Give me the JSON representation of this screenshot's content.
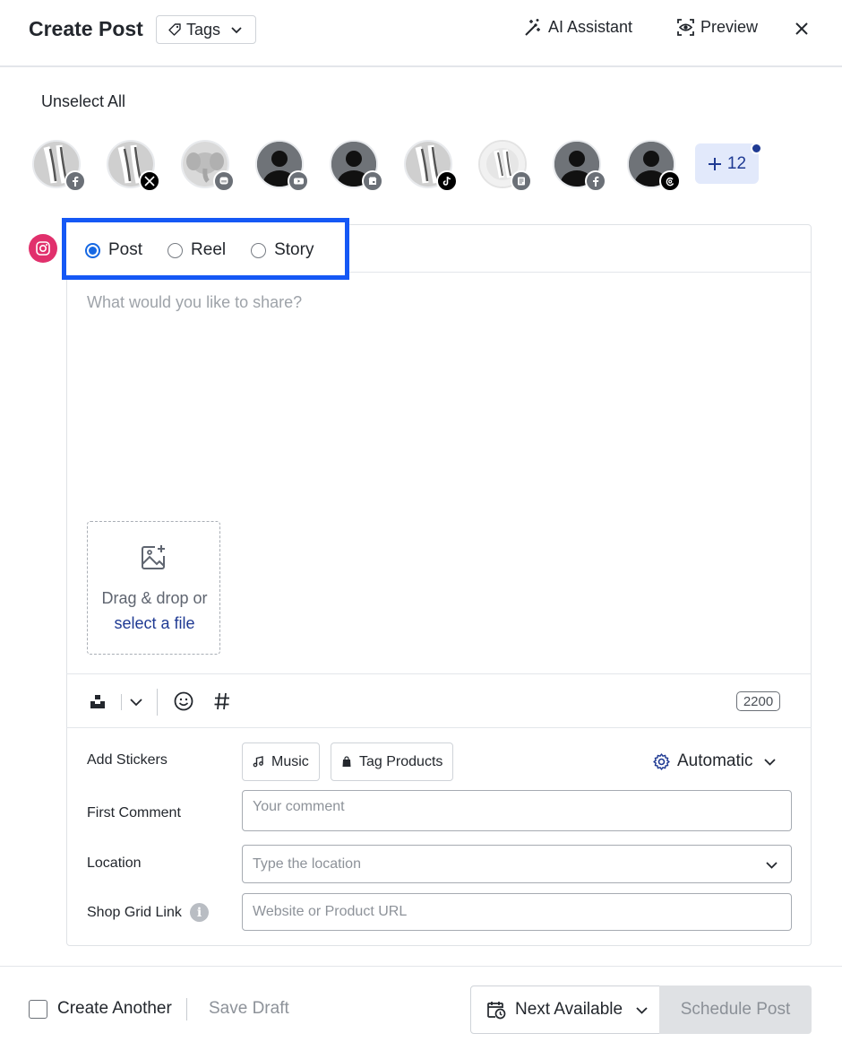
{
  "header": {
    "title": "Create Post",
    "tags_label": "Tags",
    "ai_label": "AI Assistant",
    "preview_label": "Preview"
  },
  "profiles": {
    "unselect_label": "Unselect All",
    "more_count": "12",
    "accounts": [
      {
        "type": "photo",
        "network": "facebook"
      },
      {
        "type": "photo",
        "network": "x"
      },
      {
        "type": "elephant",
        "network": "mastodon"
      },
      {
        "type": "placeholder",
        "network": "youtube"
      },
      {
        "type": "placeholder",
        "network": "google-business"
      },
      {
        "type": "photo",
        "network": "tiktok"
      },
      {
        "type": "photo",
        "network": "startpage"
      },
      {
        "type": "placeholder",
        "network": "facebook"
      },
      {
        "type": "placeholder",
        "network": "threads"
      }
    ]
  },
  "post_types": {
    "options": [
      "Post",
      "Reel",
      "Story"
    ],
    "selected": "Post"
  },
  "editor": {
    "placeholder": "What would you like to share?",
    "drop_text": "Drag & drop or",
    "drop_link": "select a file",
    "char_count": "2200"
  },
  "extras": {
    "stickers_label": "Add Stickers",
    "music_label": "Music",
    "tag_products_label": "Tag Products",
    "automatic_label": "Automatic",
    "first_comment_label": "First Comment",
    "first_comment_placeholder": "Your comment",
    "location_label": "Location",
    "location_placeholder": "Type the location",
    "shop_grid_label": "Shop Grid Link",
    "shop_grid_placeholder": "Website or Product URL"
  },
  "footer": {
    "create_another_label": "Create Another",
    "save_draft_label": "Save Draft",
    "next_available_label": "Next Available",
    "schedule_label": "Schedule Post"
  },
  "colors": {
    "accent": "#1f3a93",
    "highlight": "#1558f5",
    "instagram": "#e1306c",
    "radio": "#1668e3"
  }
}
